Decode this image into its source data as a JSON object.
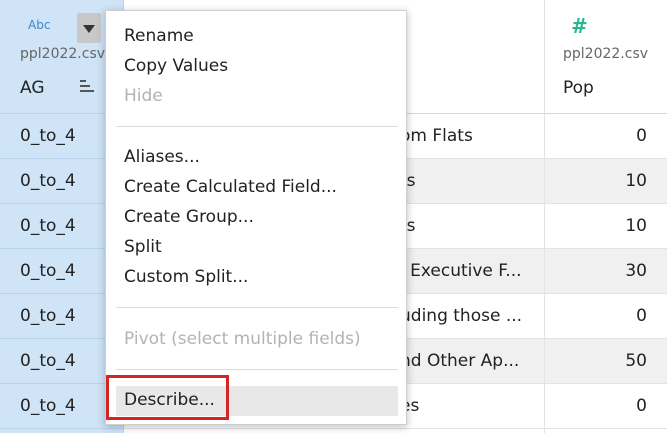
{
  "columns": {
    "ag": {
      "type_label": "Abc",
      "source": "ppl2022.csv",
      "name": "AG"
    },
    "pop": {
      "type_icon": "#",
      "source": "ppl2022.csv",
      "name": "Pop"
    }
  },
  "rows": [
    {
      "ag": "0_to_4",
      "mid": "om Flats",
      "pop": "0"
    },
    {
      "ag": "0_to_4",
      "mid": "ts",
      "pop": "10"
    },
    {
      "ag": "0_to_4",
      "mid": "ts",
      "pop": "10"
    },
    {
      "ag": "0_to_4",
      "mid": "l Executive F...",
      "pop": "30"
    },
    {
      "ag": "0_to_4",
      "mid": "uding those ...",
      "pop": "0"
    },
    {
      "ag": "0_to_4",
      "mid": "nd Other Ap...",
      "pop": "50"
    },
    {
      "ag": "0_to_4",
      "mid": "es",
      "pop": "0"
    }
  ],
  "menu": {
    "items": [
      {
        "label": "Rename",
        "disabled": false
      },
      {
        "label": "Copy Values",
        "disabled": false
      },
      {
        "label": "Hide",
        "disabled": true
      },
      {
        "label": "Aliases...",
        "disabled": false
      },
      {
        "label": "Create Calculated Field...",
        "disabled": false
      },
      {
        "label": "Create Group...",
        "disabled": false
      },
      {
        "label": "Split",
        "disabled": false
      },
      {
        "label": "Custom Split...",
        "disabled": false
      },
      {
        "label": "Pivot (select multiple fields)",
        "disabled": true
      },
      {
        "label": "Describe...",
        "disabled": false
      }
    ]
  },
  "colors": {
    "selected_column": "#cfe4f7",
    "highlight_border": "#d62323",
    "type_abc": "#3d88c9",
    "type_number": "#2bb58f"
  }
}
